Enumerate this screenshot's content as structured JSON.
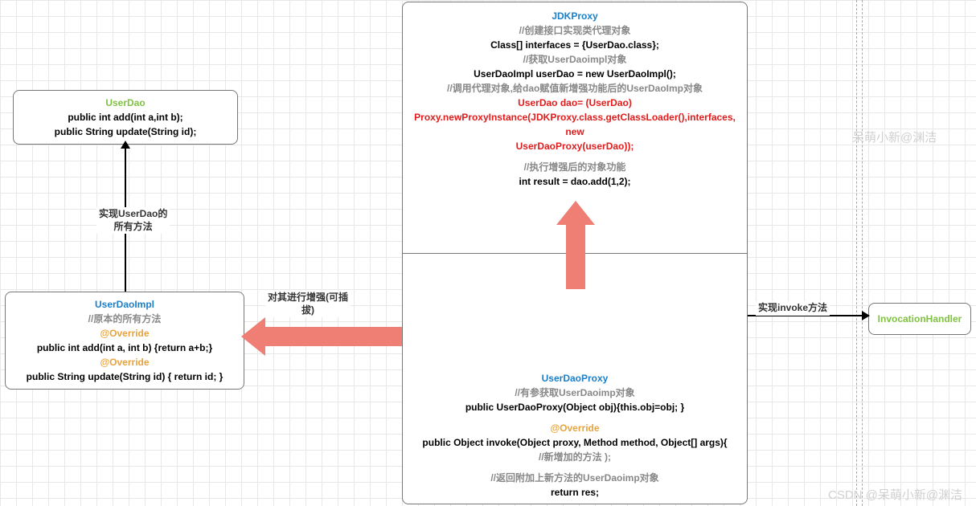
{
  "userDao": {
    "title": "UserDao",
    "line1": "public int add(int a,int b);",
    "line2": "public String update(String id);"
  },
  "userDaoImpl": {
    "title": "UserDaoImpl",
    "comment": "//原本的所有方法",
    "override1": "@Override",
    "line1": "public int add(int a, int b) {return a+b;}",
    "override2": "@Override",
    "line2": "public String update(String id) { return id; }"
  },
  "jdkProxy": {
    "title": "JDKProxy",
    "c1": "//创建接口实现类代理对象",
    "l1": "Class[] interfaces = {UserDao.class};",
    "c2": "//获取UserDaoimpl对象",
    "l2": "UserDaoImpl userDao = new UserDaoImpl();",
    "c3": "//调用代理对象,给dao赋值新增强功能后的UserDaoImp对象",
    "red1": "UserDao dao= (UserDao)",
    "red2": "Proxy.newProxyInstance(JDKProxy.class.getClassLoader(),interfaces, new",
    "red3": "UserDaoProxy(userDao));",
    "c4": "//执行增强后的对象功能",
    "l3": "int result = dao.add(1,2);"
  },
  "userDaoProxy": {
    "title": "UserDaoProxy",
    "c1": "//有参获取UserDaoimp对象",
    "l1": "public UserDaoProxy(Object obj){this.obj=obj; }",
    "override": "@Override",
    "l2": "public Object invoke(Object proxy, Method method, Object[] args){",
    "c2": "//新增加的方法 );",
    "c3": "//返回附加上新方法的UserDaoimp对象",
    "l3": "return res;"
  },
  "invocationHandler": {
    "title": "InvocationHandler"
  },
  "labels": {
    "userDaoArrow": "实现UserDao的\n所有方法",
    "enhanceArrow": "对其进行增强(可插\n拔)",
    "invokeArrow": "实现invoke方法"
  },
  "watermarks": {
    "top": "呆萌小新@渊洁",
    "bottom": "CSDN @呆萌小新@渊洁"
  }
}
